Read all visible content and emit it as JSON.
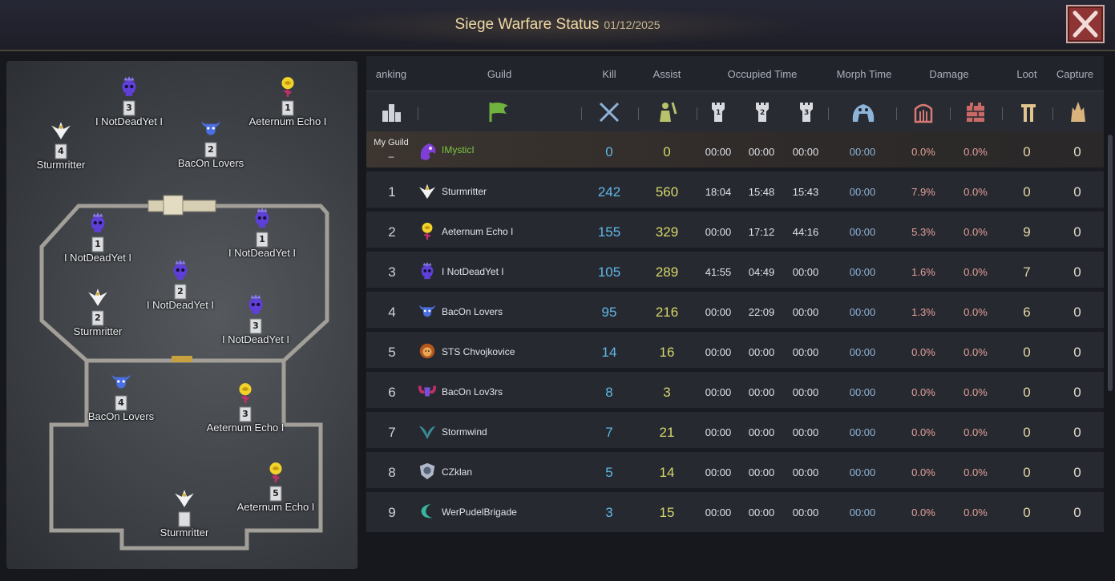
{
  "window": {
    "title": "Siege Warfare Status",
    "date": "01/12/2025"
  },
  "colors": {
    "kill": "#5fb8e8",
    "assist": "#d6d96a",
    "damage": "#e2a19a",
    "morph": "#8cb4d8",
    "my_guild": "#79c840"
  },
  "icons": {
    "ranking": "bar-chart-icon",
    "guild": "guild-flag-icon",
    "kill": "crossed-swords-icon",
    "assist": "assist-soldier-icon",
    "occupied": "shield-tower-icon",
    "morph": "golem-icon",
    "damage_gate": "gate-icon",
    "damage_wall": "wall-icon",
    "loot": "loot-pillar-icon",
    "capture": "capture-spire-icon"
  },
  "headers": {
    "ranking": "anking",
    "guild": "Guild",
    "kill": "Kill",
    "assist": "Assist",
    "occupied": "Occupied Time",
    "morph": "Morph Time",
    "damage": "Damage",
    "loot": "Loot",
    "capture": "Capture"
  },
  "tower_numbers": [
    "1",
    "2",
    "3"
  ],
  "my_guild": {
    "label": "My Guild",
    "rank": "–",
    "name": "IMysticI",
    "emblem": "purple-dragon-emblem",
    "kill": "0",
    "assist": "0",
    "t1": "00:00",
    "t2": "00:00",
    "t3": "00:00",
    "morph": "00:00",
    "dmg_gate": "0.0%",
    "dmg_wall": "0.0%",
    "loot": "0",
    "capture": "0"
  },
  "rows": [
    {
      "rank": "1",
      "name": "Sturmritter",
      "emblem": "white-eagle-emblem",
      "kill": "242",
      "assist": "560",
      "t1": "18:04",
      "t2": "15:48",
      "t3": "15:43",
      "morph": "00:00",
      "dmg_gate": "7.9%",
      "dmg_wall": "0.0%",
      "loot": "0",
      "capture": "0"
    },
    {
      "rank": "2",
      "name": "Aeternum Echo I",
      "emblem": "yellow-rose-emblem",
      "kill": "155",
      "assist": "329",
      "t1": "00:00",
      "t2": "17:12",
      "t3": "44:16",
      "morph": "00:00",
      "dmg_gate": "5.3%",
      "dmg_wall": "0.0%",
      "loot": "9",
      "capture": "0"
    },
    {
      "rank": "3",
      "name": "I NotDeadYet I",
      "emblem": "purple-skull-emblem",
      "kill": "105",
      "assist": "289",
      "t1": "41:55",
      "t2": "04:49",
      "t3": "00:00",
      "morph": "00:00",
      "dmg_gate": "1.6%",
      "dmg_wall": "0.0%",
      "loot": "7",
      "capture": "0"
    },
    {
      "rank": "4",
      "name": "BacOn Lovers",
      "emblem": "blue-bull-emblem",
      "kill": "95",
      "assist": "216",
      "t1": "00:00",
      "t2": "22:09",
      "t3": "00:00",
      "morph": "00:00",
      "dmg_gate": "1.3%",
      "dmg_wall": "0.0%",
      "loot": "6",
      "capture": "0"
    },
    {
      "rank": "5",
      "name": "STS Chvojkovice",
      "emblem": "lion-emblem",
      "kill": "14",
      "assist": "16",
      "t1": "00:00",
      "t2": "00:00",
      "t3": "00:00",
      "morph": "00:00",
      "dmg_gate": "0.0%",
      "dmg_wall": "0.0%",
      "loot": "0",
      "capture": "0"
    },
    {
      "rank": "6",
      "name": "BacOn Lov3rs",
      "emblem": "ram-emblem",
      "kill": "8",
      "assist": "3",
      "t1": "00:00",
      "t2": "00:00",
      "t3": "00:00",
      "morph": "00:00",
      "dmg_gate": "0.0%",
      "dmg_wall": "0.0%",
      "loot": "0",
      "capture": "0"
    },
    {
      "rank": "7",
      "name": "Stormwind",
      "emblem": "teal-wing-emblem",
      "kill": "7",
      "assist": "21",
      "t1": "00:00",
      "t2": "00:00",
      "t3": "00:00",
      "morph": "00:00",
      "dmg_gate": "0.0%",
      "dmg_wall": "0.0%",
      "loot": "0",
      "capture": "0"
    },
    {
      "rank": "8",
      "name": "CZklan",
      "emblem": "shield-emblem",
      "kill": "5",
      "assist": "14",
      "t1": "00:00",
      "t2": "00:00",
      "t3": "00:00",
      "morph": "00:00",
      "dmg_gate": "0.0%",
      "dmg_wall": "0.0%",
      "loot": "0",
      "capture": "0"
    },
    {
      "rank": "9",
      "name": "WerPudelBrigade",
      "emblem": "crescent-emblem",
      "kill": "3",
      "assist": "15",
      "t1": "00:00",
      "t2": "00:00",
      "t3": "00:00",
      "morph": "00:00",
      "dmg_gate": "0.0%",
      "dmg_wall": "0.0%",
      "loot": "0",
      "capture": "0"
    }
  ],
  "map_markers": [
    {
      "guild": "I NotDeadYet I",
      "number": "3",
      "emblem": "purple-skull-emblem"
    },
    {
      "guild": "Aeternum Echo I",
      "number": "1",
      "emblem": "yellow-rose-emblem"
    },
    {
      "guild": "Sturmritter",
      "number": "4",
      "emblem": "white-eagle-emblem"
    },
    {
      "guild": "BacOn Lovers",
      "number": "2",
      "emblem": "blue-bull-emblem"
    },
    {
      "guild": "I NotDeadYet I",
      "number": "1",
      "emblem": "purple-skull-emblem"
    },
    {
      "guild": "I NotDeadYet I",
      "number": "1",
      "emblem": "purple-skull-emblem"
    },
    {
      "guild": "I NotDeadYet I",
      "number": "2",
      "emblem": "purple-skull-emblem"
    },
    {
      "guild": "Sturmritter",
      "number": "2",
      "emblem": "white-eagle-emblem"
    },
    {
      "guild": "I NotDeadYet I",
      "number": "3",
      "emblem": "purple-skull-emblem"
    },
    {
      "guild": "BacOn Lovers",
      "number": "4",
      "emblem": "blue-bull-emblem"
    },
    {
      "guild": "Aeternum Echo I",
      "number": "3",
      "emblem": "yellow-rose-emblem"
    },
    {
      "guild": "Aeternum Echo I",
      "number": "5",
      "emblem": "yellow-rose-emblem"
    },
    {
      "guild": "Sturmritter",
      "number": "",
      "emblem": "white-eagle-emblem"
    }
  ]
}
